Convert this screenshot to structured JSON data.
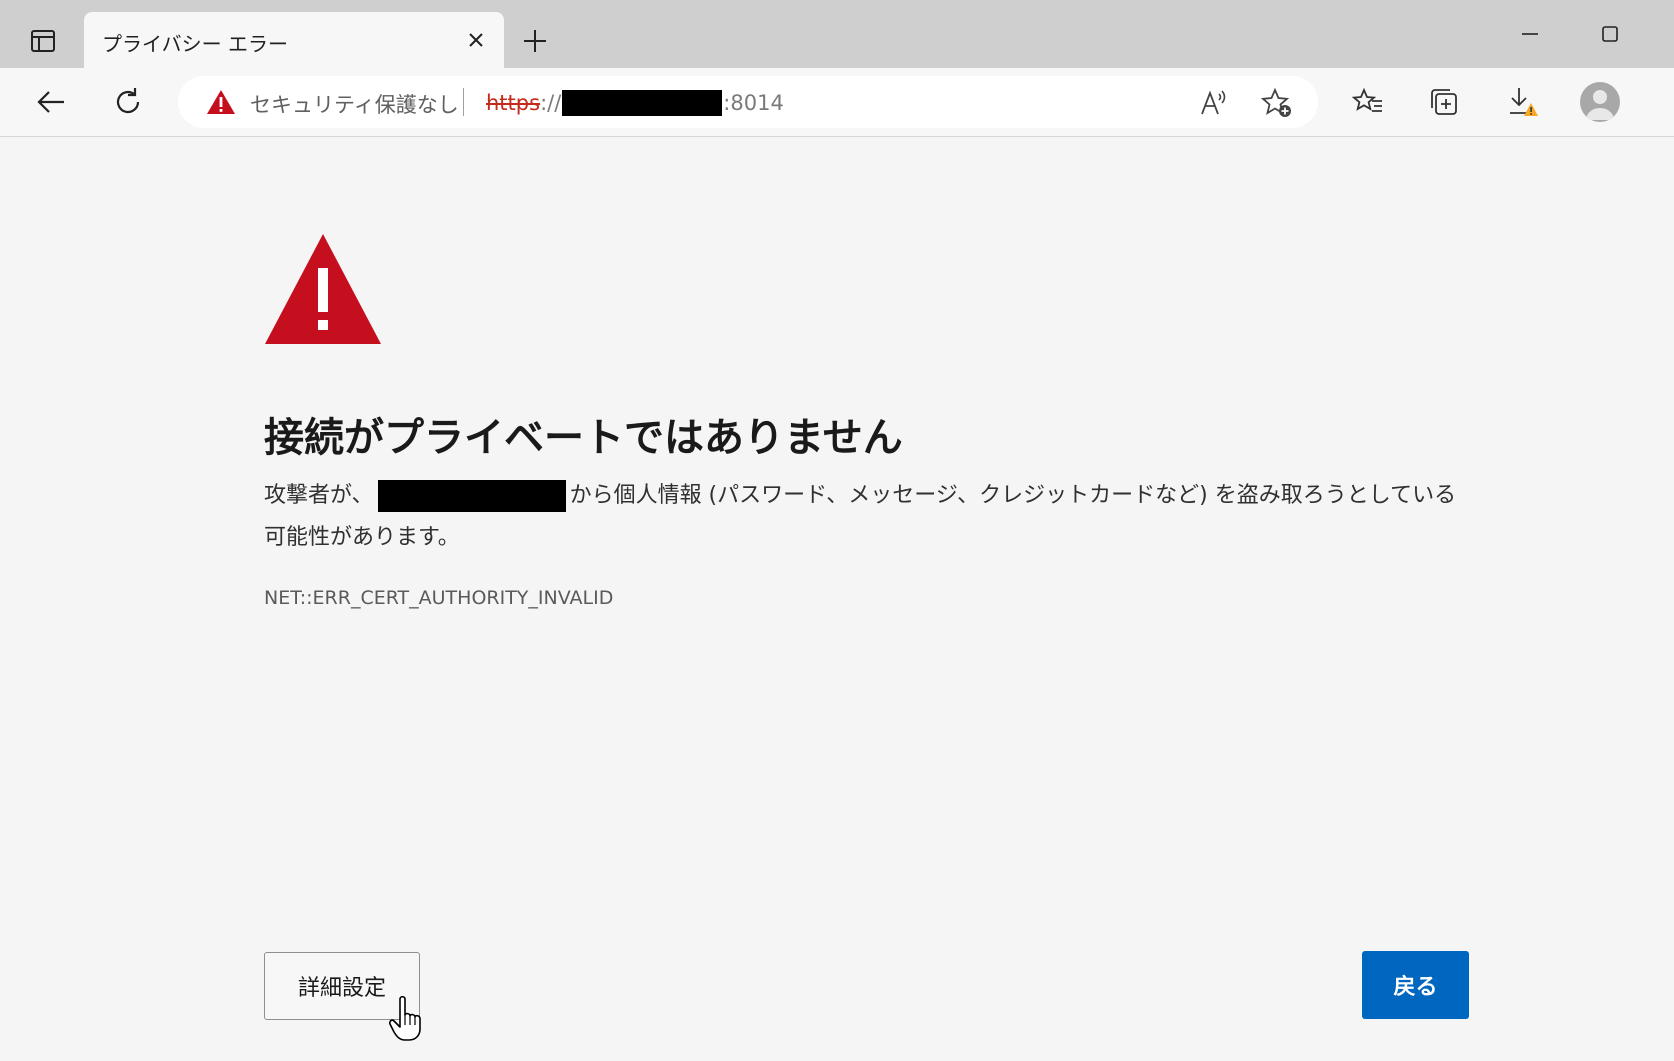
{
  "tab": {
    "title": "プライバシー エラー"
  },
  "address": {
    "security_label": "セキュリティ保護なし",
    "scheme": "https",
    "slashes": "://",
    "port": ":8014"
  },
  "page": {
    "heading": "接続がプライベートではありません",
    "message_prefix": "攻撃者が、",
    "message_suffix": "から個人情報 (パスワード、メッセージ、クレジットカードなど) を盗み取ろうとしている可能性があります。",
    "error_code": "NET::ERR_CERT_AUTHORITY_INVALID",
    "advanced_label": "詳細設定",
    "back_label": "戻る"
  },
  "colors": {
    "warning_red": "#c50f1f",
    "accent_blue": "#0067c0",
    "insecure_scheme": "#c42b1c"
  }
}
